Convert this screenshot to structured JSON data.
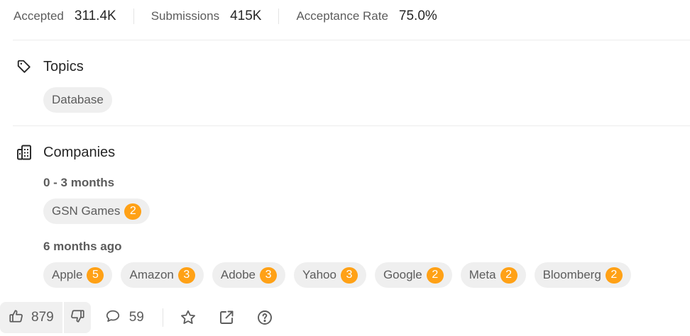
{
  "stats": [
    {
      "label": "Accepted",
      "value": "311.4K"
    },
    {
      "label": "Submissions",
      "value": "415K"
    },
    {
      "label": "Acceptance Rate",
      "value": "75.0%"
    }
  ],
  "topics": {
    "title": "Topics",
    "icon": "tag-icon",
    "items": [
      {
        "label": "Database"
      }
    ]
  },
  "companies": {
    "title": "Companies",
    "icon": "building-icon",
    "groups": [
      {
        "period": "0 - 3 months",
        "items": [
          {
            "name": "GSN Games",
            "count": "2"
          }
        ]
      },
      {
        "period": "6 months ago",
        "items": [
          {
            "name": "Apple",
            "count": "5"
          },
          {
            "name": "Amazon",
            "count": "3"
          },
          {
            "name": "Adobe",
            "count": "3"
          },
          {
            "name": "Yahoo",
            "count": "3"
          },
          {
            "name": "Google",
            "count": "2"
          },
          {
            "name": "Meta",
            "count": "2"
          },
          {
            "name": "Bloomberg",
            "count": "2"
          }
        ]
      }
    ]
  },
  "footer": {
    "likes": "879",
    "comments": "59",
    "icons": [
      "thumbs-up-icon",
      "thumbs-down-icon",
      "comment-icon",
      "star-icon",
      "share-icon",
      "help-icon"
    ]
  },
  "colors": {
    "accent": "#ffa116",
    "chip_bg": "#efefef",
    "text_muted": "#5c5c5c"
  }
}
